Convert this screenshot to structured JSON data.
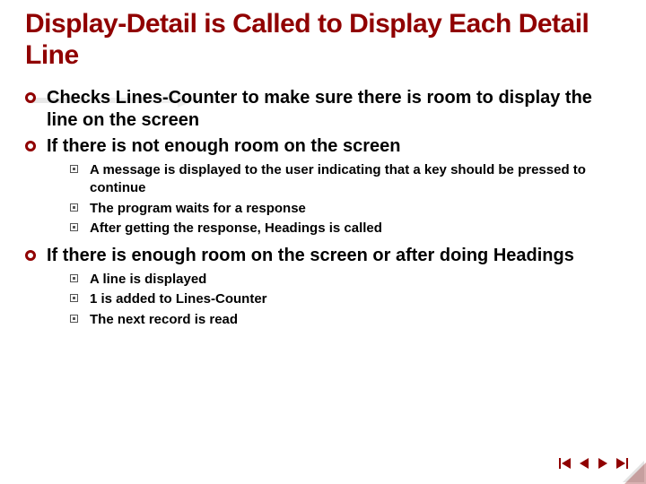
{
  "title": "Display-Detail is Called to Display Each Detail Line",
  "bullets": [
    {
      "text": "Checks Lines-Counter to make sure there is room to display the line on the screen",
      "sub": []
    },
    {
      "text": "If there is not enough room on the screen",
      "sub": [
        "A message is displayed to the user indicating that a key should be pressed to continue",
        "The program waits for a response",
        "After getting the response, Headings is called"
      ]
    },
    {
      "text": "If there is enough room on the screen or after doing Headings",
      "sub": [
        "A line is displayed",
        "1 is added to Lines-Counter",
        "The next record is read"
      ]
    }
  ],
  "nav": {
    "first": "first-slide",
    "prev": "previous-slide",
    "next": "next-slide",
    "last": "last-slide"
  },
  "colors": {
    "accent": "#900000"
  }
}
